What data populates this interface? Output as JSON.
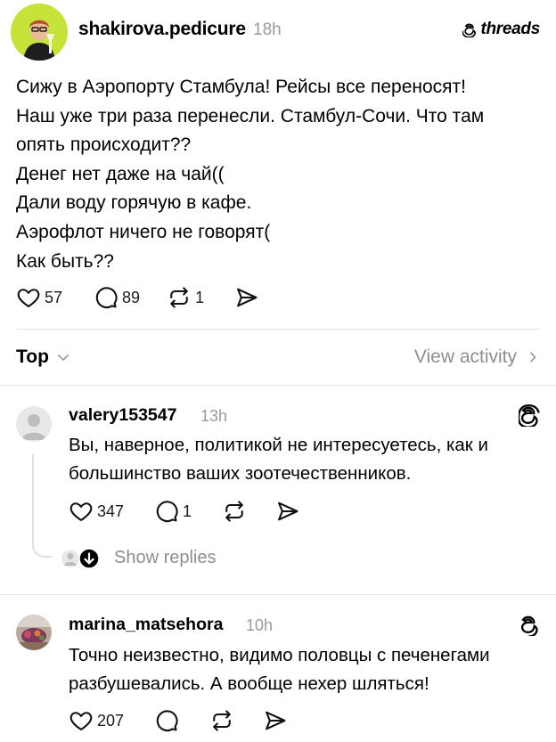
{
  "post": {
    "author": "shakirova.pedicure",
    "time": "18h",
    "brand": "threads",
    "lines": [
      "Сижу в Аэропорту Стамбула! Рейсы все переносят!",
      "Наш уже три раза перенесли. Стамбул-Сочи. Что там",
      "опять происходит??",
      "Денег нет даже на чай((",
      "Дали воду горячую в кафе.",
      "Аэрофлот ничего не говорят(",
      "Как быть??"
    ],
    "likes": "57",
    "replies": "89",
    "reposts": "1"
  },
  "sort": {
    "label": "Top",
    "view_activity": "View activity"
  },
  "comments": [
    {
      "user": "valery153547",
      "time": "13h",
      "lines": [
        "Вы, наверное, политикой не интересуетесь, как и",
        "большинство ваших зоотечественников."
      ],
      "likes": "347",
      "replies": "1",
      "show_replies": "Show replies"
    },
    {
      "user": "marina_matsehora",
      "time": "10h",
      "lines": [
        "Точно неизвестно, видимо половцы с печенегами",
        "разбушевались. А вообще нехер шляться!"
      ],
      "likes": "207"
    }
  ],
  "colors": {
    "avatar_bg": "#c6e33a",
    "muted": "#8e8e8e",
    "divider": "#e3e3e3"
  }
}
